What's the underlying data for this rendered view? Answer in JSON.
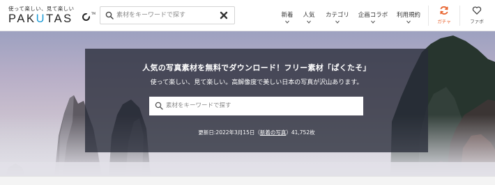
{
  "logo": {
    "tagline": "使って楽しい、見て楽しい",
    "word_part1": "PAK",
    "word_part2": "U",
    "word_part3": "TAS",
    "tm": "TM"
  },
  "header_search": {
    "placeholder": "素材をキーワードで探す",
    "value": ""
  },
  "nav": {
    "items": [
      {
        "label": "新着"
      },
      {
        "label": "人気"
      },
      {
        "label": "カテゴリ"
      },
      {
        "label": "企画コラボ"
      },
      {
        "label": "利用規約"
      }
    ],
    "gacha": {
      "label": "ガチャ",
      "icon": "refresh-icon",
      "color": "#e8632e"
    },
    "favorite": {
      "label": "ファボ",
      "icon": "heart-icon"
    }
  },
  "hero": {
    "title": "人気の写真素材を無料でダウンロード！フリー素材「ぱくたそ」",
    "subtitle": "使って楽しい、見て楽しい。高解像度で美しい日本の写真が沢山あります。",
    "search_placeholder": "素材をキーワードで探す",
    "update_prefix": "更新日:2022年3月15日（",
    "update_link": "新着の写真",
    "update_suffix": "）41,752枚"
  },
  "colors": {
    "accent_orange": "#e8632e",
    "logo_blue": "#1c9bd6",
    "overlay": "#282c38"
  }
}
